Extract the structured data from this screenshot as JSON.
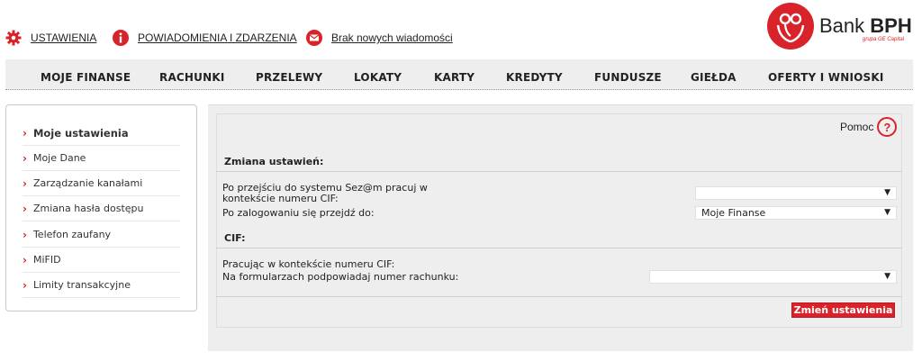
{
  "topbar": {
    "settings": "USTAWIENIA",
    "notifications": "POWIADOMIENIA I ZDARZENIA",
    "messages": "Brak nowych wiadomości"
  },
  "logo": {
    "brand": "Bank",
    "brand_bold": "BPH",
    "tagline": "grupa GE Capital"
  },
  "nav": {
    "items": [
      "MOJE FINANSE",
      "RACHUNKI",
      "PRZELEWY",
      "LOKATY",
      "KARTY",
      "KREDYTY",
      "FUNDUSZE",
      "GIEŁDA",
      "OFERTY I WNIOSKI"
    ]
  },
  "sidebar": {
    "items": [
      {
        "label": "Moje ustawienia",
        "active": true
      },
      {
        "label": "Moje Dane"
      },
      {
        "label": "Zarządzanie kanałami"
      },
      {
        "label": "Zmiana hasła dostępu"
      },
      {
        "label": "Telefon zaufany"
      },
      {
        "label": "MiFID"
      },
      {
        "label": "Limity transakcyjne"
      }
    ]
  },
  "content": {
    "help": "Pomoc",
    "help_symbol": "?",
    "section1_title": "Zmiana ustawień:",
    "row1_label_line1": "Po przejściu do systemu Sez@m pracuj w",
    "row1_label_line2": "kontekście numeru CIF:",
    "row1_value": "",
    "row2_label": "Po zalogowaniu się przejdź do:",
    "row2_value": "Moje Finanse",
    "section2_title": "CIF:",
    "row3_label": "Pracując w kontekście numeru CIF:",
    "row4_label": "Na formularzach podpowiadaj numer rachunku:",
    "row4_value": "",
    "submit": "Zmień ustawienia"
  },
  "colors": {
    "accent": "#d8232a",
    "nav_bg": "#eeeeee",
    "panel_bg": "#eeeeee"
  }
}
